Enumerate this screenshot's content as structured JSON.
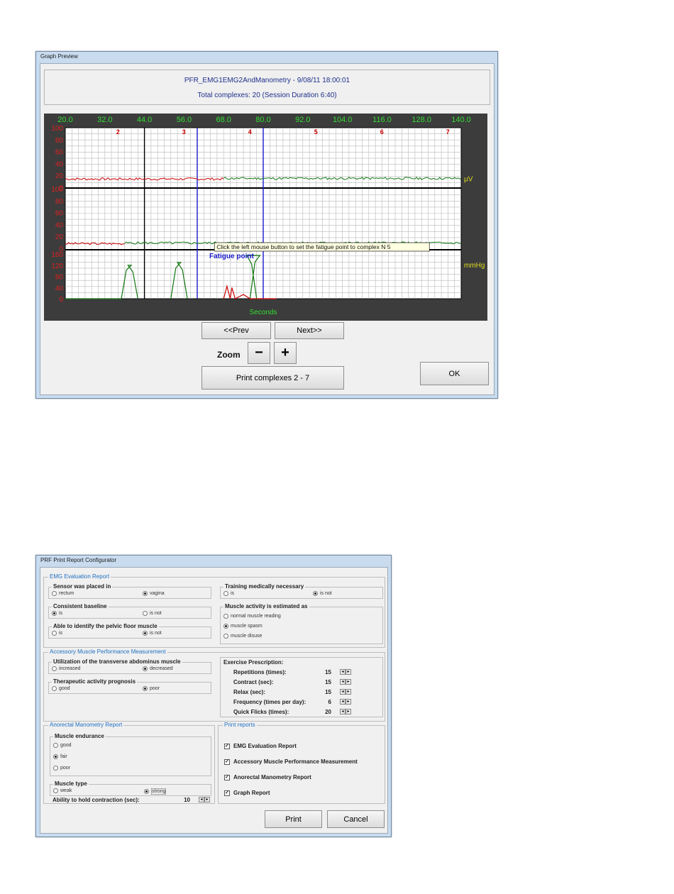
{
  "graph_window": {
    "title": "Graph Preview",
    "header_line1": "PFR_EMG1EMG2AndManometry - 9/08/11 18:00:01",
    "header_line2": "Total complexes: 20 (Session Duration 6:40)",
    "prev_label": "<<Prev",
    "next_label": "Next>>",
    "zoom_label": "Zoom",
    "zoom_minus": "−",
    "zoom_plus": "+",
    "print_label": "Print complexes 2  -  7",
    "ok_label": "OK",
    "tooltip": "Click the left mouse button to set the fatigue point to complex N 5",
    "fatigue_label": "Fatigue point",
    "colors": {
      "grid_bg": "#ffffff",
      "frame_bg": "#3c3c3c",
      "emg1": "#cc0000",
      "emg2": "#117711",
      "marker_blue": "#1a1acc"
    }
  },
  "chart_data": {
    "type": "line",
    "x_ticks": [
      "20.0",
      "32.0",
      "44.0",
      "56.0",
      "68.0",
      "80.0",
      "92.0",
      "104.0",
      "116.0",
      "128.0",
      "140.0"
    ],
    "xlabel": "Seconds",
    "complex_labels": [
      "2",
      "3",
      "4",
      "5",
      "6",
      "7"
    ],
    "panel1": {
      "ticks": [
        "100",
        "80",
        "60",
        "40",
        "20",
        "0"
      ],
      "unit": "µV"
    },
    "panel2": {
      "ticks": [
        "100",
        "80",
        "60",
        "40",
        "20",
        "0"
      ],
      "unit": ""
    },
    "panel3": {
      "ticks": [
        "160",
        "120",
        "80",
        "40",
        "0"
      ],
      "unit": "mmHg"
    }
  },
  "config_window": {
    "title": "PRF Print Report Configurator",
    "emg_section": {
      "title": "EMG Evaluation Report",
      "sensor": {
        "title": "Sensor was placed in",
        "opt1": "rectum",
        "opt2": "vagina"
      },
      "baseline": {
        "title": "Consistent baseline",
        "opt1": "is",
        "opt2": "is not"
      },
      "identify": {
        "title": "Able to identify the pelvic floor muscle",
        "opt1": "is",
        "opt2": "is not"
      },
      "training": {
        "title": "Training medically necessary",
        "opt1": "is",
        "opt2": "is not"
      },
      "activity": {
        "title": "Muscle activity is estimated as",
        "opt1": "normal muscle reading",
        "opt2": "muscle spasm",
        "opt3": "muscle disuse"
      }
    },
    "accessory_section": {
      "title": "Accessory Muscle Performance Measurement",
      "utilization": {
        "title": "Utilization of the transverse abdominus muscle",
        "opt1": "increased",
        "opt2": "decreased"
      },
      "prognosis": {
        "title": "Therapeutic activity prognosis",
        "opt1": "good",
        "opt2": "poor"
      },
      "exercise": {
        "title": "Exercise Prescription:",
        "rows": [
          {
            "label": "Repetitions (times):",
            "value": "15"
          },
          {
            "label": "Contract (sec):",
            "value": "15"
          },
          {
            "label": "Relax (sec):",
            "value": "15"
          },
          {
            "label": "Frequency (times per day):",
            "value": "6"
          },
          {
            "label": "Quick Flicks (times):",
            "value": "20"
          }
        ]
      }
    },
    "anorectal_section": {
      "title": "Anorectal Manometry Report",
      "endurance": {
        "title": "Muscle endurance",
        "opt1": "good",
        "opt2": "fair",
        "opt3": "poor"
      },
      "type": {
        "title": "Muscle type",
        "opt1": "weak",
        "opt2": "strong"
      },
      "hold_label": "Ability to hold contraction (sec):",
      "hold_value": "10"
    },
    "print_section": {
      "title": "Print reports",
      "items": [
        "EMG Evaluation Report",
        "Accessory Muscle Performance Measurement",
        "Anorectal Manometry Report",
        "Graph Report"
      ]
    },
    "print_label": "Print",
    "cancel_label": "Cancel"
  }
}
